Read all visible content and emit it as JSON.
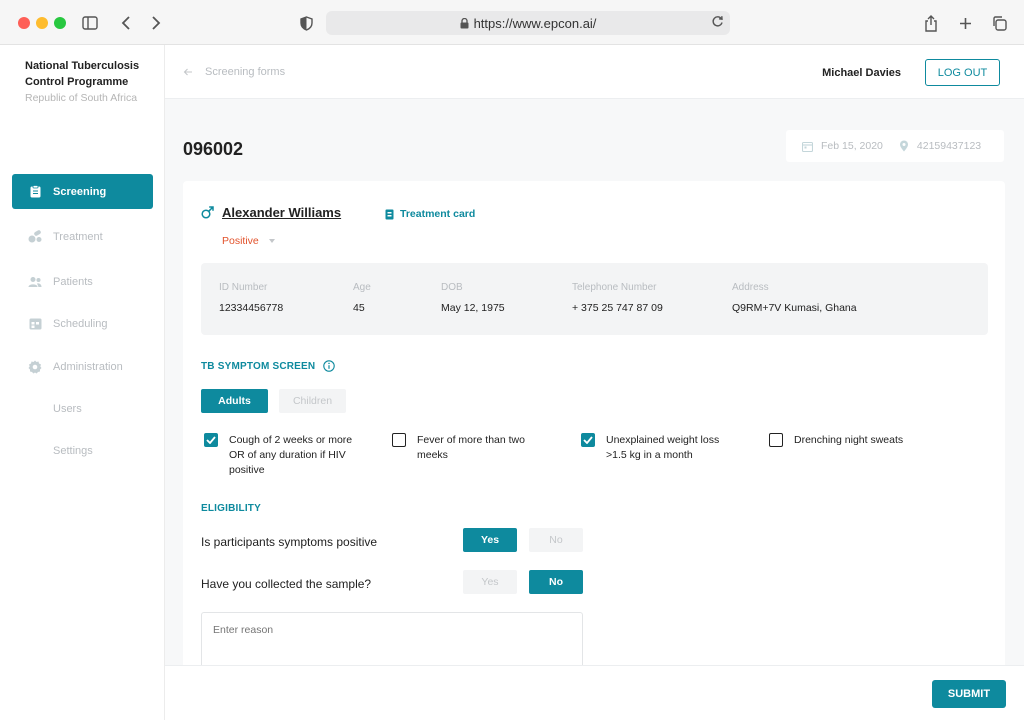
{
  "browser": {
    "url": "https://www.epcon.ai/"
  },
  "sidebar": {
    "org_name_line1": "National Tuberculosis",
    "org_name_line2": "Control Programme",
    "org_country": "Republic of South Africa",
    "items": [
      {
        "label": "Screening",
        "icon": "clipboard-icon",
        "active": true
      },
      {
        "label": "Treatment",
        "icon": "pills-icon",
        "active": false
      },
      {
        "label": "Patients",
        "icon": "people-icon",
        "active": false
      },
      {
        "label": "Scheduling",
        "icon": "calendar-icon",
        "active": false
      },
      {
        "label": "Administration",
        "icon": "gear-icon",
        "active": false
      }
    ],
    "sub_items": [
      {
        "label": "Users"
      },
      {
        "label": "Settings"
      }
    ]
  },
  "header": {
    "breadcrumb": "Screening forms",
    "user_name": "Michael Davies",
    "logout_label": "LOG OUT"
  },
  "record": {
    "id": "096002",
    "date": "Feb 15, 2020",
    "location_code": "42159437123"
  },
  "patient": {
    "name": "Alexander Williams",
    "gender_icon": "male-icon",
    "status": "Positive",
    "treatment_card_label": "Treatment card",
    "info": [
      {
        "label": "ID Number",
        "value": "12334456778"
      },
      {
        "label": "Age",
        "value": "45"
      },
      {
        "label": "DOB",
        "value": "May 12, 1975"
      },
      {
        "label": "Telephone Number",
        "value": "+ 375 25 747 87 09"
      },
      {
        "label": "Address",
        "value": "Q9RM+7V Kumasi, Ghana"
      }
    ]
  },
  "symptom_screen": {
    "title": "TB SYMPTOM SCREEN",
    "tabs": [
      {
        "label": "Adults",
        "active": true
      },
      {
        "label": "Children",
        "active": false
      }
    ],
    "symptoms": [
      {
        "lines": [
          "Cough of 2 weeks or more",
          "OR of any duration if HIV",
          "positive"
        ],
        "checked": true
      },
      {
        "lines": [
          "Fever of more than two",
          "meeks"
        ],
        "checked": false
      },
      {
        "lines": [
          "Unexplained weight loss",
          ">1.5 kg in a month"
        ],
        "checked": true
      },
      {
        "lines": [
          "Drenching night sweats"
        ],
        "checked": false
      }
    ]
  },
  "eligibility": {
    "title": "ELIGIBILITY",
    "questions": [
      {
        "text": "Is participants symptoms positive",
        "yes": "Yes",
        "no": "No",
        "selected": "yes"
      },
      {
        "text": "Have you collected the sample?",
        "yes": "Yes",
        "no": "No",
        "selected": "no"
      }
    ],
    "reason_placeholder": "Enter reason"
  },
  "footer": {
    "submit_label": "SUBMIT"
  },
  "colors": {
    "accent": "#0e8a9e",
    "status_positive": "#e2522b"
  }
}
